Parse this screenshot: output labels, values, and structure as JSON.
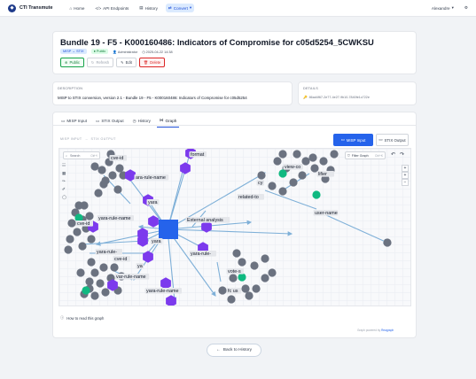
{
  "app": {
    "brand": "CTI Transmute",
    "nav": [
      {
        "label": "Home",
        "icon": "home-icon"
      },
      {
        "label": "API Endpoints",
        "icon": "code-icon"
      },
      {
        "label": "History",
        "icon": "history-icon"
      },
      {
        "label": "Convert",
        "icon": "convert-icon"
      }
    ],
    "user": "Alexandre",
    "settings_icon": "gear-icon"
  },
  "header": {
    "title": "Bundle 19 - F5 - K000160486: Indicators of Compromise for c05d5254_5CWKSU",
    "format_badge": "MISP → STIX",
    "status_badge": "Public",
    "author": "Administrator",
    "timestamp": "2025-04-22 14:38",
    "actions": {
      "public": "Public",
      "refresh": "Refresh",
      "edit": "Edit",
      "delete": "Delete"
    }
  },
  "description": {
    "label": "DESCRIPTION",
    "text": "MISP to STIX conversion, version 2.1 - Bundle 19 - F5 - K000160486: Indicators of Compromise for c05d5254"
  },
  "details": {
    "label": "DETAILS",
    "uuid": "86ad4f67-2e77-4e27-9b10-7840fe1c722e"
  },
  "tabs": [
    {
      "label": "MISP Input",
      "icon": "file-icon"
    },
    {
      "label": "STIX Output",
      "icon": "file-icon"
    },
    {
      "label": "History",
      "icon": "history-icon"
    },
    {
      "label": "Graph",
      "icon": "graph-icon"
    }
  ],
  "graph": {
    "legend_left": "MISP INPUT",
    "legend_arrow": "→",
    "legend_right": "STIX OUTPUT",
    "btn_misp": "MISP Input",
    "btn_stix": "STIX Output",
    "search_placeholder": "Search",
    "search_shortcut": "Ctrl+/",
    "filter_label": "Filter Graph",
    "filter_shortcut": "Ctrl+K",
    "zoom_in": "+",
    "zoom_reset": "+",
    "zoom_out": "−",
    "labels": {
      "format": "format",
      "ara_rule_name": "ara-rule-name",
      "cve_id_top": "cve-id",
      "yara_top": "yara",
      "external_analysis": "External analysis",
      "yara_rule_name_left": "yara-rule-name",
      "cve_id_left": "cve-id",
      "yara_rule_left2": "yara-rule-",
      "yara_mid": "yara",
      "ya": "ya",
      "var_rule_name": "var-rule-name",
      "yara_rule_name_bottom": "yara-rule-name",
      "format_bottom": "format",
      "view_co": "view-co",
      "lifier": "lifier",
      "related_to": "related-to",
      "user_name": "user-name",
      "yara_rule_right": "yara-rule-",
      "vote_s": "vote-s",
      "fc_us": "fc us",
      "cve_id_bottom": "cve-id",
      "cy": "cy"
    },
    "colors": {
      "observable": "#6b7280",
      "indicator": "#7c3aed",
      "report": "#2563eb",
      "vulnerability": "#10b981",
      "edge": "#7fb0d8"
    }
  },
  "footer": {
    "how_to": "How to read this graph",
    "powered_prefix": "Graph powered by",
    "powered_link": "Reagraph",
    "back": "Back to History"
  }
}
